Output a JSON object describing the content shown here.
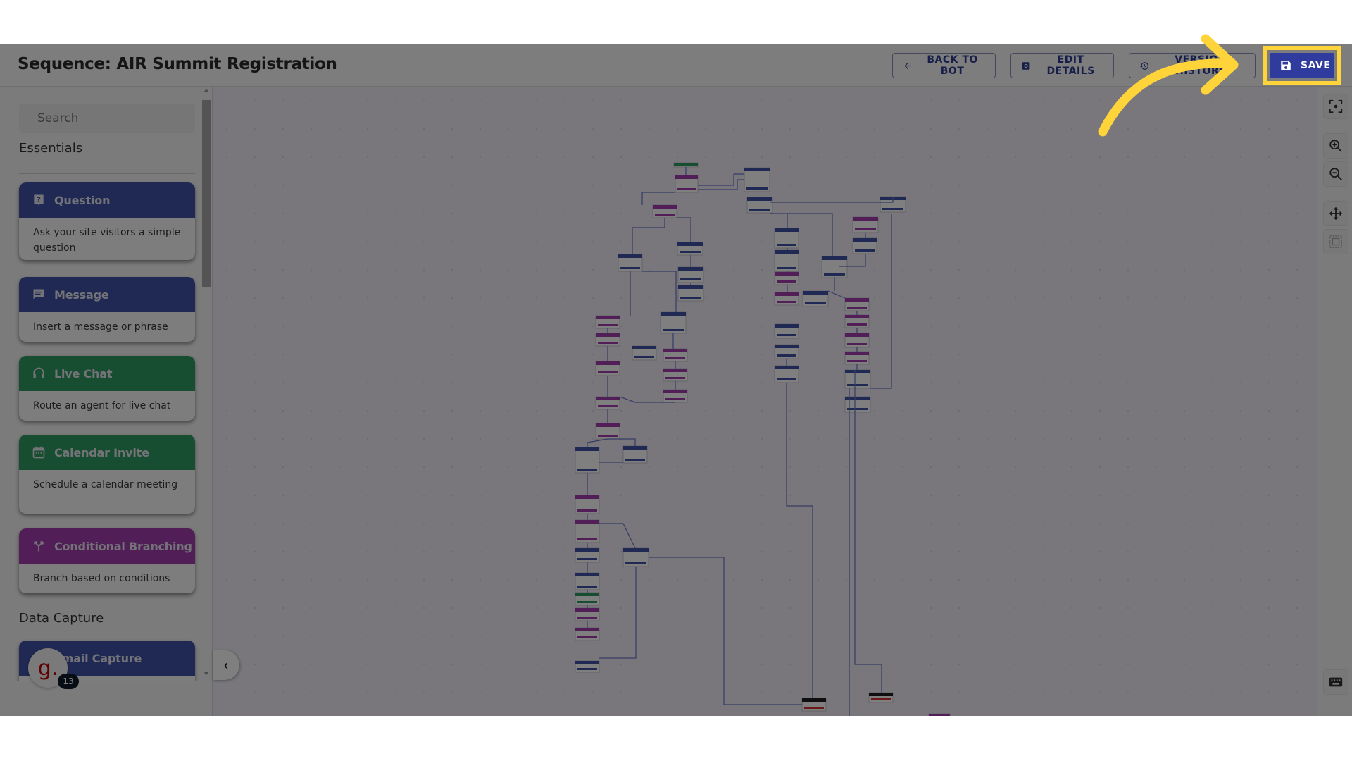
{
  "header": {
    "title": "Sequence: AIR Summit Registration",
    "buttons": {
      "back": "BACK TO BOT",
      "edit": "EDIT DETAILS",
      "version": "VERSION HISTORY",
      "save": "SAVE"
    }
  },
  "sidebar": {
    "search_placeholder": "Search",
    "sections": [
      {
        "title": "Essentials",
        "cards": [
          {
            "label": "Question",
            "description": "Ask your site visitors a simple question",
            "icon": "question-icon",
            "color": "#3f53a8"
          },
          {
            "label": "Message",
            "description": "Insert a message or phrase",
            "icon": "message-icon",
            "color": "#3f53a8"
          },
          {
            "label": "Live Chat",
            "description": "Route an agent for live chat",
            "icon": "headset-icon",
            "color": "#2e9a63"
          },
          {
            "label": "Calendar Invite",
            "description": "Schedule a calendar meeting",
            "icon": "calendar-icon",
            "color": "#2e9a63"
          },
          {
            "label": "Conditional Branching",
            "description": "Branch based on conditions",
            "icon": "branch-icon",
            "color": "#a33db0"
          }
        ]
      },
      {
        "title": "Data Capture",
        "cards": [
          {
            "label": "Email Capture",
            "description": "",
            "icon": "email-icon",
            "color": "#3f53a8"
          }
        ]
      }
    ]
  },
  "chat_widget": {
    "logo": "g.",
    "count": "13"
  },
  "toolbar": {
    "items": [
      "focus-icon",
      "zoom-in-icon",
      "zoom-out-icon",
      "pan-icon",
      "select-area-icon",
      "keyboard-icon"
    ]
  },
  "annotation": {
    "highlight_color": "#ffd43b",
    "target": "SAVE"
  },
  "colors": {
    "primary": "#2f3c9e",
    "question": "#3f53a8",
    "live_chat": "#2e9a63",
    "branch": "#a33db0",
    "end": "#1f1f1f",
    "error": "#d33"
  }
}
